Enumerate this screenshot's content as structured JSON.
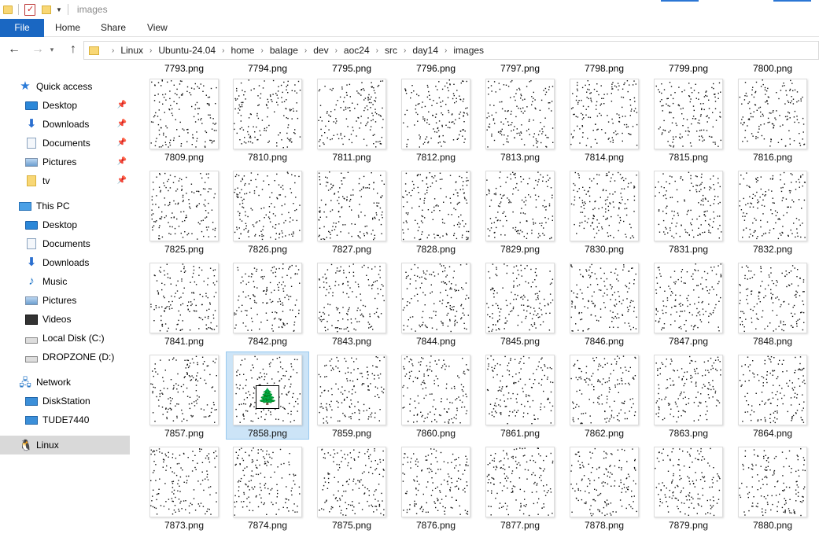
{
  "window": {
    "title": "images"
  },
  "ribbon": {
    "tabs": [
      "File",
      "Home",
      "Share",
      "View"
    ]
  },
  "address": {
    "crumbs": [
      "Linux",
      "Ubuntu-24.04",
      "home",
      "balage",
      "dev",
      "aoc24",
      "src",
      "day14",
      "images"
    ]
  },
  "sidebar": {
    "quick_access": {
      "label": "Quick access",
      "icon": "star-icon"
    },
    "quick_items": [
      {
        "label": "Desktop",
        "icon": "desktop-icon",
        "pinned": true
      },
      {
        "label": "Downloads",
        "icon": "download-icon",
        "pinned": true
      },
      {
        "label": "Documents",
        "icon": "document-icon",
        "pinned": true
      },
      {
        "label": "Pictures",
        "icon": "pictures-icon",
        "pinned": true
      },
      {
        "label": "tv",
        "icon": "folder-icon",
        "pinned": true
      }
    ],
    "this_pc": {
      "label": "This PC",
      "icon": "computer-icon"
    },
    "pc_items": [
      {
        "label": "Desktop",
        "icon": "desktop-icon"
      },
      {
        "label": "Documents",
        "icon": "document-icon"
      },
      {
        "label": "Downloads",
        "icon": "download-icon"
      },
      {
        "label": "Music",
        "icon": "music-icon"
      },
      {
        "label": "Pictures",
        "icon": "pictures-icon"
      },
      {
        "label": "Videos",
        "icon": "video-icon"
      },
      {
        "label": "Local Disk (C:)",
        "icon": "disk-icon"
      },
      {
        "label": "DROPZONE (D:)",
        "icon": "disk-icon"
      }
    ],
    "network": {
      "label": "Network",
      "icon": "network-icon"
    },
    "network_items": [
      {
        "label": "DiskStation",
        "icon": "monitor-icon"
      },
      {
        "label": "TUDE7440",
        "icon": "monitor-icon"
      }
    ],
    "linux": {
      "label": "Linux",
      "icon": "penguin-icon",
      "selected": true
    }
  },
  "grid": {
    "top_labels": [
      "7793.png",
      "7794.png",
      "7795.png",
      "7796.png",
      "7797.png",
      "7798.png",
      "7799.png",
      "7800.png"
    ],
    "rows": [
      [
        "7809.png",
        "7810.png",
        "7811.png",
        "7812.png",
        "7813.png",
        "7814.png",
        "7815.png",
        "7816.png"
      ],
      [
        "7825.png",
        "7826.png",
        "7827.png",
        "7828.png",
        "7829.png",
        "7830.png",
        "7831.png",
        "7832.png"
      ],
      [
        "7841.png",
        "7842.png",
        "7843.png",
        "7844.png",
        "7845.png",
        "7846.png",
        "7847.png",
        "7848.png"
      ],
      [
        "7857.png",
        "7858.png",
        "7859.png",
        "7860.png",
        "7861.png",
        "7862.png",
        "7863.png",
        "7864.png"
      ],
      [
        "7873.png",
        "7874.png",
        "7875.png",
        "7876.png",
        "7877.png",
        "7878.png",
        "7879.png",
        "7880.png"
      ]
    ],
    "selected_file": "7858.png",
    "selected_thumb_icon": "christmas-tree-icon"
  }
}
